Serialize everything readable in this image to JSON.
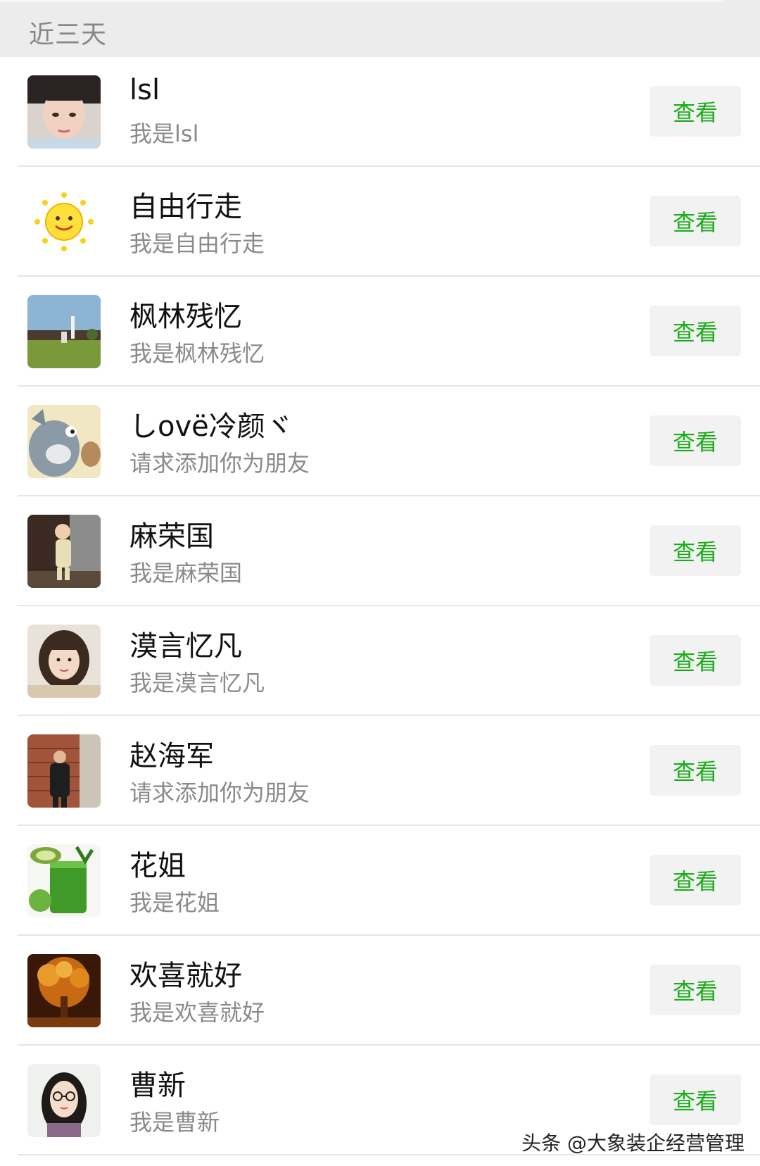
{
  "section": {
    "title": "近三天"
  },
  "requests": [
    {
      "name": "lsl",
      "message": "我是lsl",
      "button": "查看",
      "avatar": "woman-face"
    },
    {
      "name": "自由行走",
      "message": "我是自由行走",
      "button": "查看",
      "avatar": "sun-emoji"
    },
    {
      "name": "枫林残忆",
      "message": "我是枫林残忆",
      "button": "查看",
      "avatar": "landscape-photo"
    },
    {
      "name": "しovë冷颜ヾ",
      "message": "请求添加你为朋友",
      "button": "查看",
      "avatar": "cartoon-cat"
    },
    {
      "name": "麻荣国",
      "message": "我是麻荣国",
      "button": "查看",
      "avatar": "child-photo"
    },
    {
      "name": "漠言忆凡",
      "message": "我是漠言忆凡",
      "button": "查看",
      "avatar": "woman-portrait"
    },
    {
      "name": "赵海军",
      "message": "请求添加你为朋友",
      "button": "查看",
      "avatar": "man-brick-wall"
    },
    {
      "name": "花姐",
      "message": "我是花姐",
      "button": "查看",
      "avatar": "green-juice"
    },
    {
      "name": "欢喜就好",
      "message": "我是欢喜就好",
      "button": "查看",
      "avatar": "autumn-tree"
    },
    {
      "name": "曹新",
      "message": "我是曹新",
      "button": "查看",
      "avatar": "woman-glasses"
    }
  ],
  "watermark": "头条 @大象装企经营管理",
  "colors": {
    "accent": "#1aad19",
    "header_bg": "#ececec",
    "button_bg": "#f2f2f2"
  }
}
